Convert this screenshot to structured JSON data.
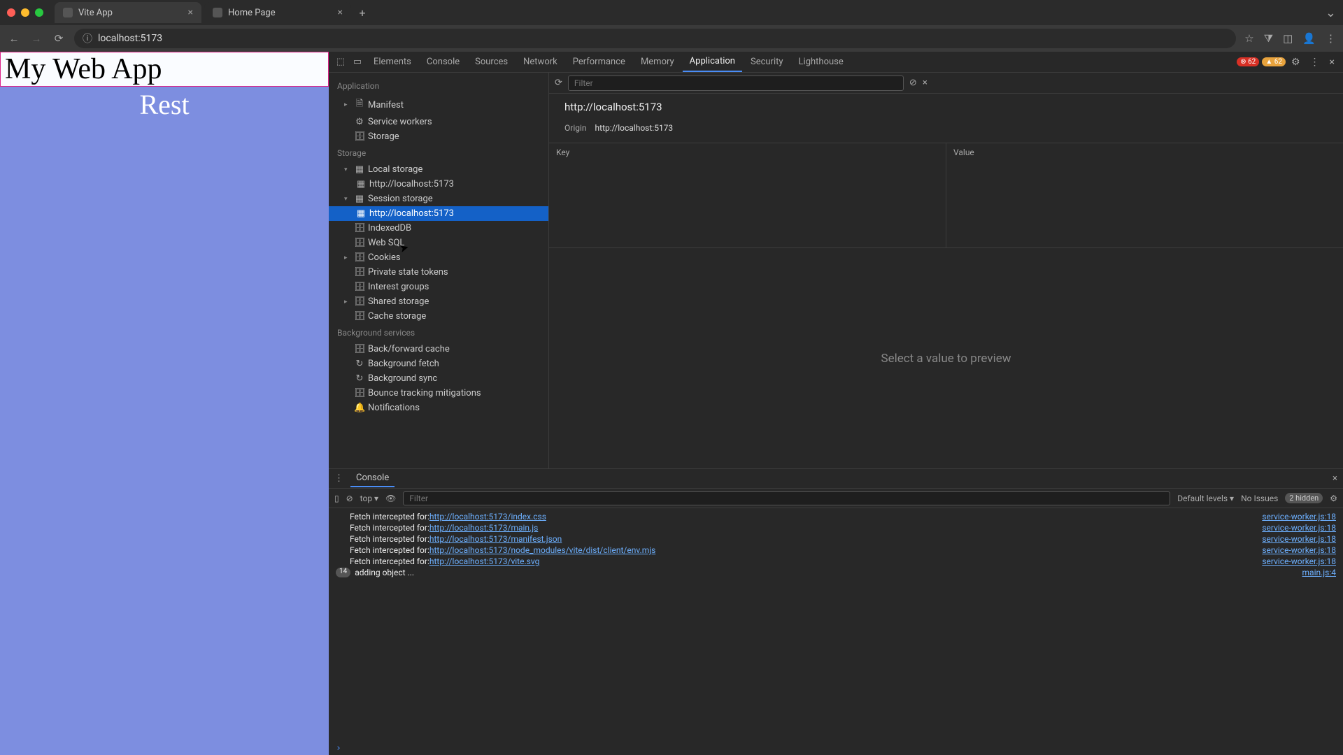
{
  "browser": {
    "tabs": [
      {
        "title": "Vite App",
        "active": true
      },
      {
        "title": "Home Page",
        "active": false
      }
    ],
    "url": "localhost:5173"
  },
  "page": {
    "heading": "My Web App",
    "subheading": "Rest"
  },
  "devtools": {
    "tabs": [
      "Elements",
      "Console",
      "Sources",
      "Network",
      "Performance",
      "Memory",
      "Application",
      "Security",
      "Lighthouse"
    ],
    "active_tab": "Application",
    "errors": "62",
    "warnings": "62",
    "sidebar": {
      "section_app": "Application",
      "app_items": [
        "Manifest",
        "Service workers",
        "Storage"
      ],
      "section_storage": "Storage",
      "local_storage": "Local storage",
      "local_storage_child": "http://localhost:5173",
      "session_storage": "Session storage",
      "session_storage_child": "http://localhost:5173",
      "indexed_db": "IndexedDB",
      "web_sql": "Web SQL",
      "cookies": "Cookies",
      "private_tokens": "Private state tokens",
      "interest_groups": "Interest groups",
      "shared_storage": "Shared storage",
      "cache_storage": "Cache storage",
      "section_bg": "Background services",
      "bg_items": [
        "Back/forward cache",
        "Background fetch",
        "Background sync",
        "Bounce tracking mitigations",
        "Notifications"
      ]
    },
    "content": {
      "filter_placeholder": "Filter",
      "title": "http://localhost:5173",
      "origin_label": "Origin",
      "origin_value": "http://localhost:5173",
      "col_key": "Key",
      "col_value": "Value",
      "preview_msg": "Select a value to preview"
    },
    "drawer": {
      "tab": "Console",
      "context": "top",
      "filter_placeholder": "Filter",
      "levels": "Default levels",
      "issues": "No Issues",
      "hidden": "2 hidden",
      "fetch_prefix": "Fetch intercepted for: ",
      "lines": [
        {
          "url": "http://localhost:5173/index.css",
          "src": "service-worker.js:18"
        },
        {
          "url": "http://localhost:5173/main.js",
          "src": "service-worker.js:18"
        },
        {
          "url": "http://localhost:5173/manifest.json",
          "src": "service-worker.js:18"
        },
        {
          "url": "http://localhost:5173/node_modules/vite/dist/client/env.mjs",
          "src": "service-worker.js:18"
        },
        {
          "url": "http://localhost:5173/vite.svg",
          "src": "service-worker.js:18"
        }
      ],
      "count_line": {
        "count": "14",
        "msg": "adding object ...",
        "src": "main.js:4"
      }
    }
  }
}
